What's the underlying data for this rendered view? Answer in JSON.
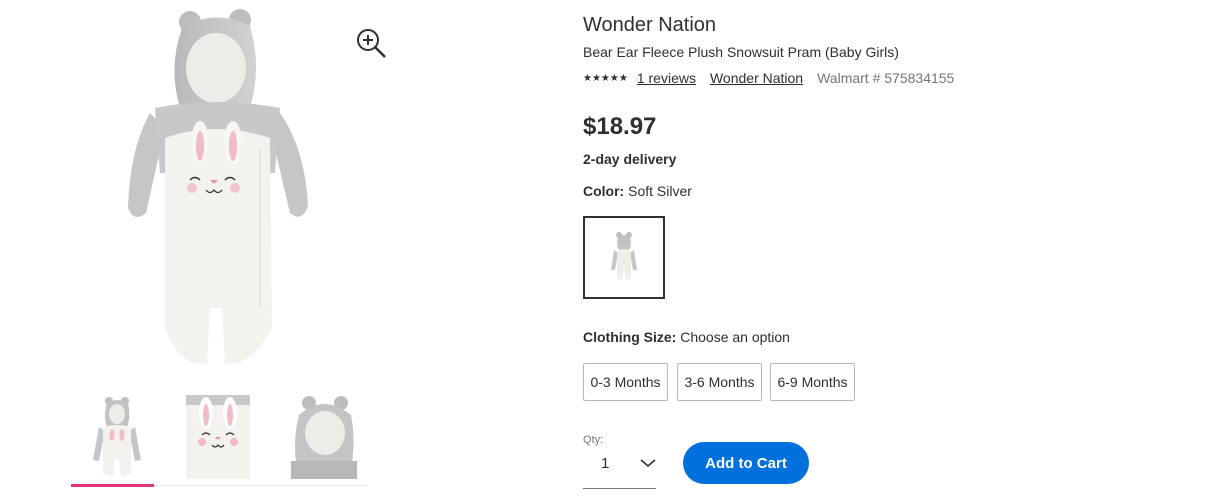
{
  "product": {
    "brand": "Wonder Nation",
    "name": "Bear Ear Fleece Plush Snowsuit Pram (Baby Girls)",
    "rating_stars": "★★★★★",
    "reviews_link": "1 reviews",
    "brand_link": "Wonder Nation",
    "walmart_number": "Walmart # 575834155",
    "price": "$18.97",
    "delivery": "2-day delivery"
  },
  "color": {
    "label": "Color:",
    "value": "Soft Silver"
  },
  "size": {
    "label": "Clothing Size:",
    "value": "Choose an option",
    "options": [
      "0-3 Months",
      "3-6 Months",
      "6-9 Months"
    ]
  },
  "quantity": {
    "label": "Qty:",
    "value": "1"
  },
  "cart": {
    "button_label": "Add to Cart"
  },
  "colors": {
    "accent_blue": "#0071dc",
    "thumb_active": "#e1327f"
  },
  "icons": {
    "zoom": "zoom-in-icon",
    "chevron": "chevron-down-icon"
  }
}
